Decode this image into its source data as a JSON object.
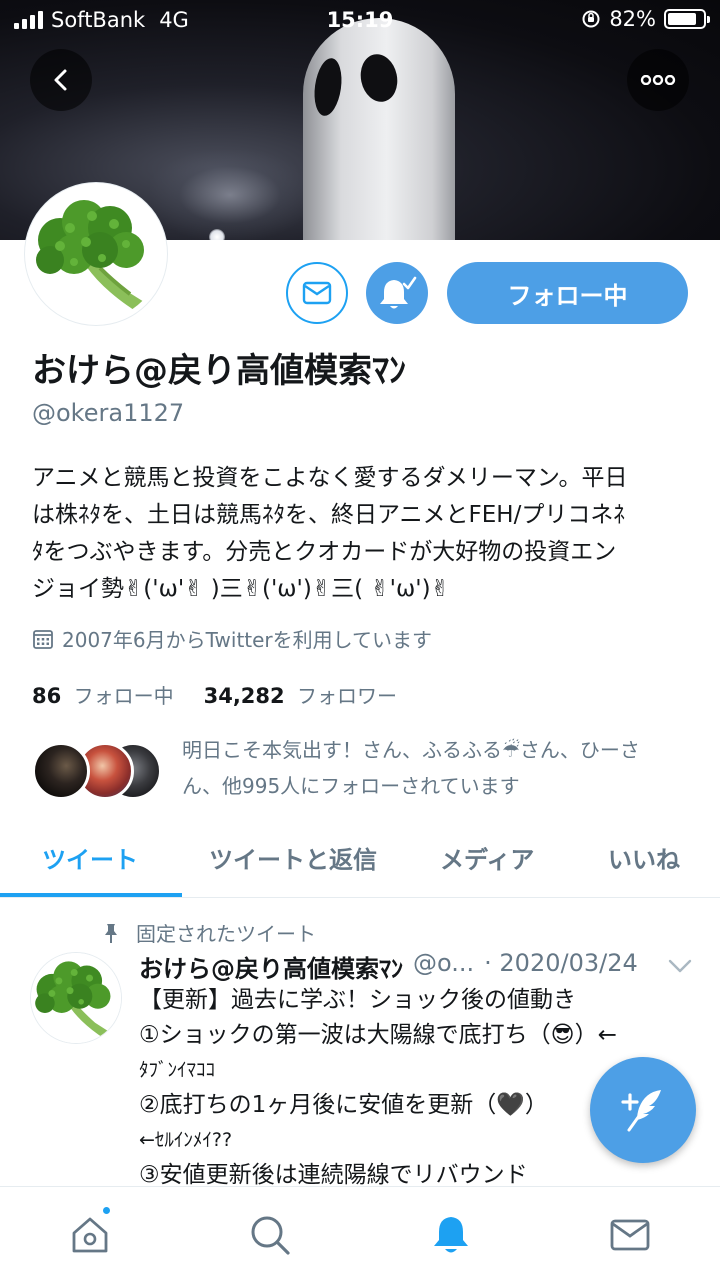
{
  "status_bar": {
    "carrier": "SoftBank",
    "network": "4G",
    "time": "15:19",
    "battery": "82%",
    "battery_level": 0.82
  },
  "profile": {
    "display_name": "おけら@戻り高値模索ﾏﾝ",
    "handle": "@okera1127",
    "bio_lines": [
      "アニメと競馬と投資をこよなく愛するダメリーマン。平日",
      "は株ﾈﾀを、土日は競馬ﾈﾀを、終日アニメとFEH/プリコネﾈ",
      "ﾀをつぶやきます。分売とクオカードが大好物の投資エン",
      "ジョイ勢✌('ω'✌ )三✌('ω')✌三( ✌'ω')✌"
    ],
    "joined": "2007年6月からTwitterを利用しています",
    "following_count": "86",
    "following_label": "フォロー中",
    "followers_count": "34,282",
    "followers_label": "フォロワー",
    "followed_by_lines": [
      "明日こそ本気出す！さん、ふるふる☔さん、ひーさ",
      "ん、他995人にフォローされています"
    ]
  },
  "actions": {
    "follow_label": "フォロー中"
  },
  "tabs": [
    {
      "label": "ツイート",
      "active": true
    },
    {
      "label": "ツイートと返信",
      "active": false
    },
    {
      "label": "メディア",
      "active": false
    },
    {
      "label": "いいね",
      "active": false
    }
  ],
  "tweet": {
    "pinned_label": "固定されたツイート",
    "author": "おけら@戻り高値模索ﾏﾝ",
    "handle_truncated": "@o...",
    "date": "· 2020/03/24",
    "lines": [
      "【更新】過去に学ぶ！ショック後の値動き",
      "①ショックの第一波は大陽線で底打ち（😎）←",
      "ﾀﾌﾞﾝｲﾏｺｺ",
      "②底打ちの1ヶ月後に安値を更新（🖤）",
      "←ｾﾙｲﾝﾒｲ??",
      "③安値更新後は連続陽線でリバウンド"
    ]
  },
  "icons": {
    "back": "back-arrow-icon",
    "more": "more-dots-icon",
    "message": "envelope-icon",
    "notifications": "bell-check-icon",
    "calendar": "calendar-icon",
    "pin": "pin-icon",
    "chevron": "chevron-down-icon",
    "compose": "compose-feather-icon",
    "nav_home": "home-icon",
    "nav_search": "search-icon",
    "nav_notifications": "bell-icon",
    "nav_messages": "envelope-icon"
  },
  "colors": {
    "accent": "#1da1f2",
    "button_blue": "#4d9fe6",
    "secondary_text": "#657786"
  }
}
